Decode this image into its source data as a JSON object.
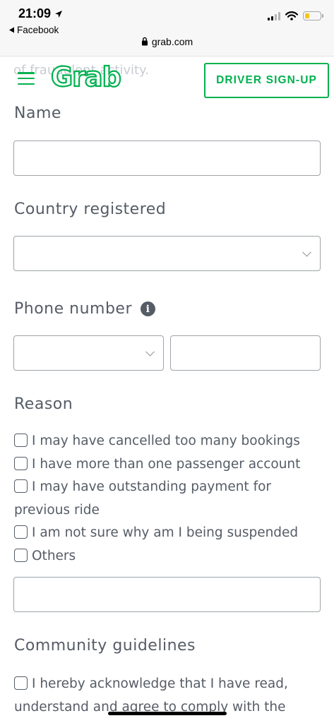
{
  "status_bar": {
    "time": "21:09",
    "back_app": "Facebook",
    "url": "grab.com",
    "battery_color": "#f5c518"
  },
  "header": {
    "background_text": "of fraudulent activity.",
    "menu_icon": "hamburger-icon",
    "logo_text": "Grab",
    "driver_signup_label": "DRIVER SIGN-UP",
    "brand_color": "#00b14f"
  },
  "form": {
    "name_label": "Name",
    "name_value": "",
    "country_label": "Country registered",
    "country_value": "",
    "phone_label": "Phone number",
    "phone_info_icon": "info-icon",
    "phone_code_value": "",
    "phone_value": "",
    "reason_label": "Reason",
    "reasons": [
      "I may have cancelled too many bookings",
      "I have more than one passenger account",
      "I may have outstanding payment for previous ride",
      "I am not sure why am I being suspended",
      "Others"
    ],
    "others_value": "",
    "guidelines_label": "Community guidelines",
    "guidelines_text": "I hereby acknowledge that I have read, understand and agree to comply with the"
  }
}
